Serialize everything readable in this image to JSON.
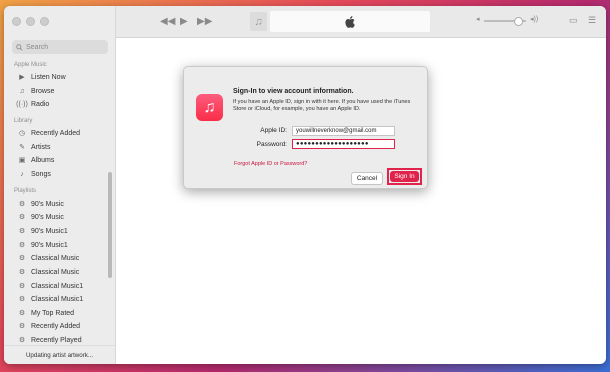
{
  "sidebar": {
    "search_placeholder": "Search",
    "sections": [
      {
        "title": "Apple Music",
        "items": [
          {
            "label": "Listen Now",
            "icon": "play-circle-icon"
          },
          {
            "label": "Browse",
            "icon": "music-note-icon"
          },
          {
            "label": "Radio",
            "icon": "radio-waves-icon"
          }
        ]
      },
      {
        "title": "Library",
        "items": [
          {
            "label": "Recently Added",
            "icon": "clock-icon"
          },
          {
            "label": "Artists",
            "icon": "microphone-icon"
          },
          {
            "label": "Albums",
            "icon": "album-icon"
          },
          {
            "label": "Songs",
            "icon": "music-note-icon"
          }
        ]
      },
      {
        "title": "Playlists",
        "items": [
          {
            "label": "90's Music",
            "icon": "gear-icon"
          },
          {
            "label": "90's Music",
            "icon": "gear-icon"
          },
          {
            "label": "90's Music1",
            "icon": "gear-icon"
          },
          {
            "label": "90's Music1",
            "icon": "gear-icon"
          },
          {
            "label": "Classical Music",
            "icon": "gear-icon"
          },
          {
            "label": "Classical Music",
            "icon": "gear-icon"
          },
          {
            "label": "Classical Music1",
            "icon": "gear-icon"
          },
          {
            "label": "Classical Music1",
            "icon": "gear-icon"
          },
          {
            "label": "My Top Rated",
            "icon": "gear-icon"
          },
          {
            "label": "Recently Added",
            "icon": "gear-icon"
          },
          {
            "label": "Recently Played",
            "icon": "gear-icon"
          }
        ]
      }
    ],
    "status": "Updating artist artwork..."
  },
  "toolbar": {
    "rewind_icon": "rewind-icon",
    "play_icon": "play-icon",
    "forward_icon": "fast-forward-icon",
    "lcd_icon": "apple-logo-icon"
  },
  "dialog": {
    "title": "Sign-In to view account information.",
    "description": "If you have an Apple ID, sign in with it here. If you have used the iTunes Store or iCloud, for example, you have an Apple ID.",
    "apple_id_label": "Apple ID:",
    "apple_id_value": "youwillneverknow@gmail.com",
    "password_label": "Password:",
    "password_value": "●●●●●●●●●●●●●●●●●●●",
    "forgot_link": "Forgot Apple ID or Password?",
    "cancel_label": "Cancel",
    "signin_label": "Sign In"
  },
  "colors": {
    "accent": "#e0234a",
    "sidebar_bg": "#ececec"
  }
}
